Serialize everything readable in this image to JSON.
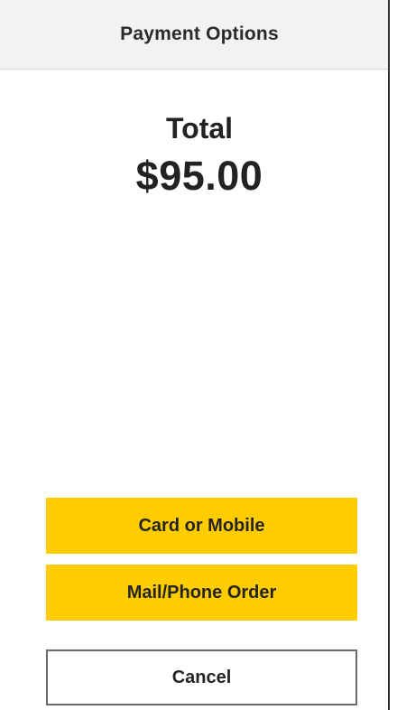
{
  "header": {
    "title": "Payment Options"
  },
  "summary": {
    "label": "Total",
    "amount": "$95.00"
  },
  "actions": {
    "card_or_mobile": "Card or Mobile",
    "mail_phone_order": "Mail/Phone Order",
    "cancel": "Cancel"
  },
  "colors": {
    "accent": "#ffcc00",
    "header_bg": "#f2f2f2",
    "text": "#222222",
    "cancel_border": "#6a6a6a"
  }
}
